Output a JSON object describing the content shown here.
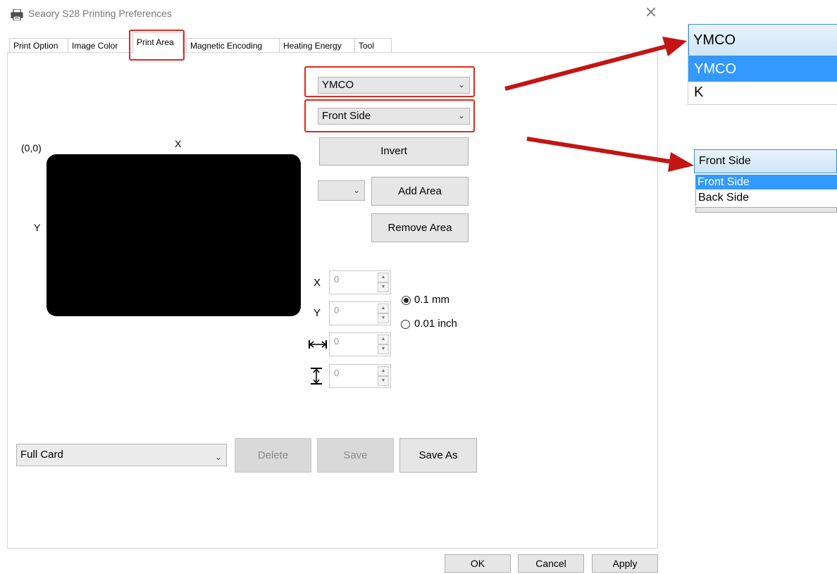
{
  "window": {
    "title": "Seaory S28 Printing Preferences",
    "close_symbol": "✕"
  },
  "tabs": [
    {
      "label": "Print Option",
      "active": false
    },
    {
      "label": "Image Color",
      "active": false
    },
    {
      "label": "Print Area",
      "active": true
    },
    {
      "label": "Magnetic Encoding",
      "active": false
    },
    {
      "label": "Heating Energy",
      "active": false
    },
    {
      "label": "Tool",
      "active": false
    }
  ],
  "print_area": {
    "color_select": "YMCO",
    "side_select": "Front Side",
    "invert_label": "Invert",
    "area_select": "",
    "add_area_label": "Add Area",
    "remove_area_label": "Remove Area",
    "origin_label": "(0,0)",
    "x_axis_label": "X",
    "y_axis_label": "Y",
    "fields": {
      "x_label": "X",
      "x_value": "0",
      "y_label": "Y",
      "y_value": "0",
      "width_value": "0",
      "height_value": "0"
    },
    "unit_options": [
      {
        "label": "0.1 mm",
        "selected": true
      },
      {
        "label": "0.01 inch",
        "selected": false
      }
    ],
    "preset_select": "Full Card",
    "delete_label": "Delete",
    "save_label": "Save",
    "save_as_label": "Save As",
    "card_color": "#000000"
  },
  "footer": {
    "ok_label": "OK",
    "cancel_label": "Cancel",
    "apply_label": "Apply"
  },
  "annotations": {
    "highlight_color": "#e0291f",
    "arrow_color": "#c41414",
    "color_popup": {
      "current": "YMCO",
      "options": [
        "YMCO",
        "K"
      ],
      "selected": "YMCO"
    },
    "side_popup": {
      "current": "Front Side",
      "options": [
        "Front Side",
        "Back Side"
      ],
      "selected": "Front Side"
    }
  }
}
